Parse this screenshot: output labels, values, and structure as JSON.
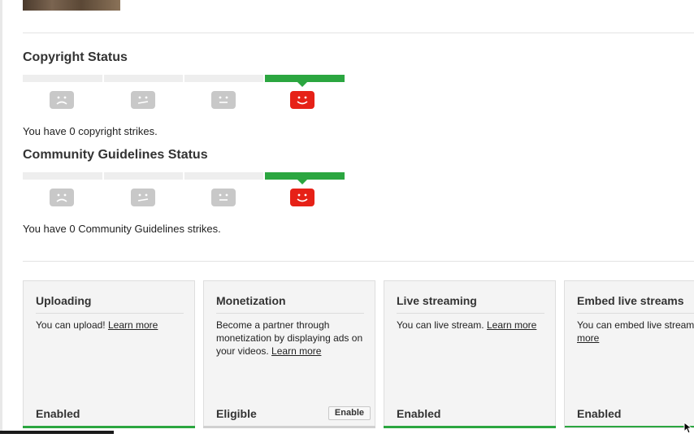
{
  "copyright": {
    "title": "Copyright Status",
    "strike_text": "You have 0 copyright strikes."
  },
  "community": {
    "title": "Community Guidelines Status",
    "strike_text": "You have 0 Community Guidelines strikes."
  },
  "meter": {
    "active_level": 4,
    "levels": 4,
    "faces": [
      "frown-icon",
      "skeptical-face-icon",
      "neutral-face-icon",
      "smile-face-icon"
    ]
  },
  "colors": {
    "active_green": "#2ba640",
    "inactive_grey": "#eeeeee",
    "face_grey": "#c8c8c8",
    "face_red": "#e62117"
  },
  "features": [
    {
      "title": "Uploading",
      "desc": "You can upload!",
      "link": "Learn more",
      "status": "Enabled"
    },
    {
      "title": "Monetization",
      "desc": "Become a partner through monetization by displaying ads on your videos.",
      "link": "Learn more",
      "status": "Eligible",
      "button": "Enable"
    },
    {
      "title": "Live streaming",
      "desc": "You can live stream.",
      "link": "Learn more",
      "status": "Enabled"
    },
    {
      "title": "Embed live streams",
      "desc": "You can embed live streams",
      "link": "Learn more",
      "status": "Enabled"
    }
  ]
}
